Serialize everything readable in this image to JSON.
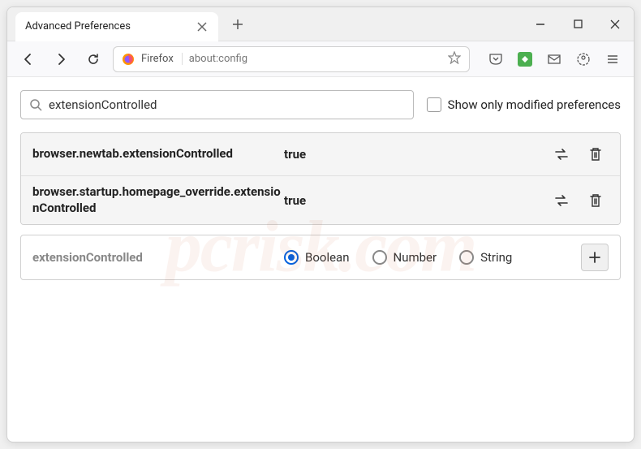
{
  "window": {
    "tab_title": "Advanced Preferences"
  },
  "toolbar": {
    "url_identity": "Firefox",
    "url": "about:config"
  },
  "search": {
    "value": "extensionControlled",
    "show_modified_label": "Show only modified preferences"
  },
  "prefs": [
    {
      "name": "browser.newtab.extensionControlled",
      "value": "true"
    },
    {
      "name": "browser.startup.homepage_override.extensionControlled",
      "value": "true"
    }
  ],
  "new_pref": {
    "name": "extensionControlled",
    "types": [
      "Boolean",
      "Number",
      "String"
    ],
    "selected": "Boolean"
  },
  "watermark": "pcrisk.com"
}
